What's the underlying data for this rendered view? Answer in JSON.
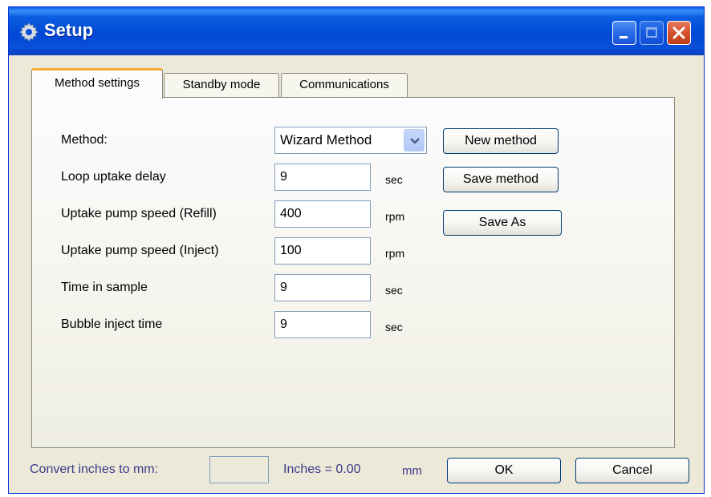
{
  "window": {
    "title": "Setup"
  },
  "tabs": [
    {
      "label": "Method settings",
      "active": true
    },
    {
      "label": "Standby mode",
      "active": false
    },
    {
      "label": "Communications",
      "active": false
    }
  ],
  "method_settings": {
    "method_label": "Method:",
    "method_value": "Wizard Method",
    "fields": [
      {
        "label": "Loop uptake delay",
        "value": "9",
        "unit": "sec"
      },
      {
        "label": "Uptake pump speed (Refill)",
        "value": "400",
        "unit": "rpm"
      },
      {
        "label": "Uptake pump speed (Inject)",
        "value": "100",
        "unit": "rpm"
      },
      {
        "label": "Time in sample",
        "value": "9",
        "unit": "sec"
      },
      {
        "label": "Bubble inject time",
        "value": "9",
        "unit": "sec"
      }
    ],
    "buttons": {
      "new_method": "New method",
      "save_method": "Save method",
      "save_as": "Save As"
    }
  },
  "footer": {
    "convert_label": "Convert inches to mm:",
    "convert_value": "",
    "inches_equals": "Inches = 0.00",
    "mm_unit": "mm",
    "ok": "OK",
    "cancel": "Cancel"
  },
  "colors": {
    "titlebar": "#0049d6",
    "window_bg": "#ece9d8",
    "active_tab_accent": "#f8a832",
    "close_button": "#d6512e",
    "footer_text": "#3a3a8a"
  },
  "icons": {
    "title": "gear-icon",
    "minimize": "minimize-icon",
    "maximize": "maximize-icon",
    "close": "close-icon",
    "dropdown": "chevron-down-icon"
  }
}
